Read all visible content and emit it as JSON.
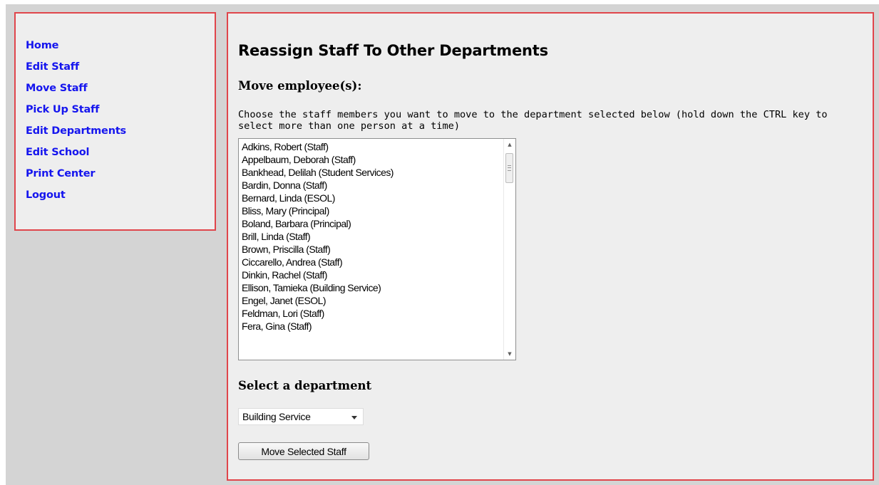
{
  "nav": {
    "items": [
      {
        "label": "Home"
      },
      {
        "label": "Edit Staff"
      },
      {
        "label": "Move Staff"
      },
      {
        "label": "Pick Up Staff"
      },
      {
        "label": "Edit Departments"
      },
      {
        "label": "Edit School"
      },
      {
        "label": "Print Center"
      },
      {
        "label": "Logout"
      }
    ]
  },
  "main": {
    "title": "Reassign Staff To Other Departments",
    "move_heading": "Move employee(s):",
    "instructions": "Choose the staff members you want to move to the department selected below (hold down the CTRL key to select more than one person at a time)",
    "staff_list": [
      "Adkins, Robert (Staff)",
      "Appelbaum, Deborah (Staff)",
      "Bankhead, Delilah (Student Services)",
      "Bardin, Donna (Staff)",
      "Bernard, Linda (ESOL)",
      "Bliss, Mary (Principal)",
      "Boland, Barbara (Principal)",
      "Brill, Linda (Staff)",
      "Brown, Priscilla (Staff)",
      "Ciccarello, Andrea (Staff)",
      "Dinkin, Rachel (Staff)",
      "Ellison, Tamieka (Building Service)",
      "Engel, Janet (ESOL)",
      "Feldman, Lori (Staff)",
      "Fera, Gina (Staff)"
    ],
    "department_heading": "Select a department",
    "department_selected": "Building Service",
    "move_button_label": "Move Selected Staff"
  },
  "colors": {
    "border": "#e0454b",
    "link": "#1515ee",
    "panel_bg": "#eeeeee",
    "page_bg": "#d4d4d4"
  }
}
